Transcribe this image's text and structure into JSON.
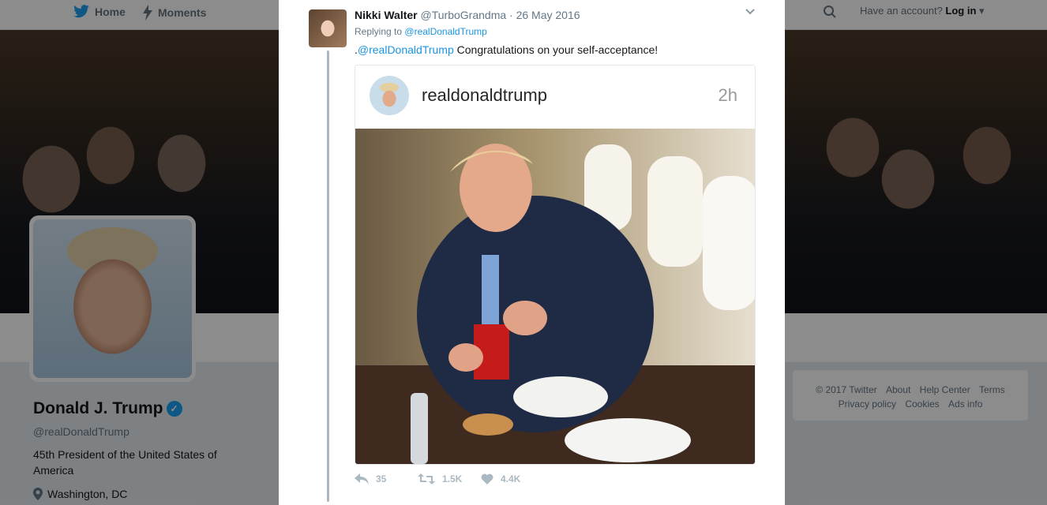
{
  "nav": {
    "home": "Home",
    "moments": "Moments",
    "login_prompt": "Have an account?",
    "login_link": "Log in"
  },
  "profile": {
    "name": "Donald J. Trump",
    "handle": "@realDonaldTrump",
    "bio": "45th President of the United States of America",
    "location": "Washington, DC"
  },
  "footer": {
    "links_row1": [
      "© 2017 Twitter",
      "About",
      "Help Center",
      "Terms"
    ],
    "links_row2": [
      "Privacy policy",
      "Cookies",
      "Ads info"
    ]
  },
  "tweet": {
    "author_name": "Nikki Walter",
    "author_handle": "@TurboGrandma",
    "separator": "·",
    "date": "26 May 2016",
    "replying_label": "Replying to",
    "replying_to": "@realDonaldTrump",
    "text_prefix": ".",
    "text_mention": "@realDonaldTrump",
    "text_body": " Congratulations on your self-acceptance!",
    "embed": {
      "username": "realdonaldtrump",
      "time": "2h"
    },
    "actions": {
      "replies": "35",
      "retweets": "1.5K",
      "likes": "4.4K"
    }
  },
  "icons": {
    "home": "bird-icon",
    "moments": "lightning-icon",
    "search": "search-icon",
    "location": "pin-icon",
    "verified": "verified-icon"
  },
  "colors": {
    "accent": "#1da1f2",
    "link": "#1b95e0",
    "muted": "#657786"
  }
}
